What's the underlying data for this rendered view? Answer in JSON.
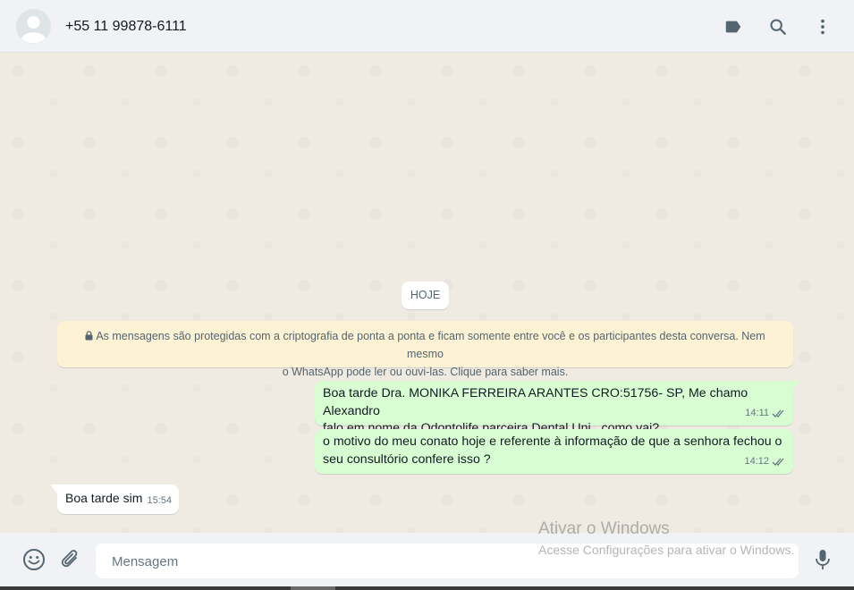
{
  "header": {
    "contact_name": "+55 11 99878-6111",
    "icons": [
      "avatar-placeholder",
      "label-icon",
      "search-icon",
      "more-vertical-icon"
    ]
  },
  "chat": {
    "day_chip": "HOJE",
    "encryption_notice_line1": "As mensagens são protegidas com a criptografia de ponta a ponta e ficam somente entre você e os participantes desta conversa. Nem mesmo",
    "encryption_notice_line2": "o WhatsApp pode ler ou ouvi-las. Clique para saber mais.",
    "messages": [
      {
        "direction": "outgoing",
        "line1": "Boa tarde Dra. MONIKA FERREIRA ARANTES CRO:51756- SP, Me chamo Alexandro",
        "line2": "falo em nome da Odontolife parceira Dental Uni , como vai?",
        "time": "14:11",
        "status": "delivered-double-check"
      },
      {
        "direction": "outgoing",
        "line1": "o motivo do meu conato hoje e referente à informação de que a senhora fechou o",
        "line2": "seu consultório confere isso ?",
        "time": "14:12",
        "status": "delivered-double-check"
      },
      {
        "direction": "incoming",
        "line1": "Boa tarde sim",
        "time": "15:54"
      }
    ]
  },
  "composer": {
    "placeholder": "Mensagem",
    "icons": [
      "emoji-icon",
      "attach-icon",
      "microphone-icon"
    ]
  },
  "watermark": {
    "line1": "Ativar o Windows",
    "line2": "Acesse Configurações para ativar o Windows."
  },
  "colors": {
    "outgoing_bubble": "#d9fdd3",
    "incoming_bubble": "#ffffff",
    "notice_bg": "#fdf3d4",
    "chat_bg": "#efeae2",
    "header_bg": "#f0f2f5"
  }
}
